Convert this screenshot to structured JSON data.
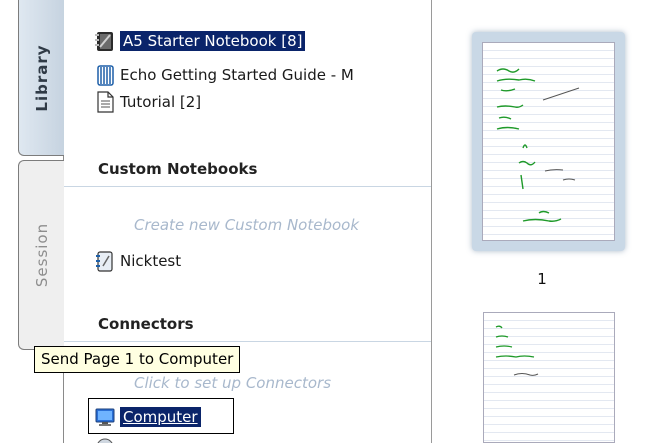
{
  "tabs": {
    "library": "Library",
    "session": "Session"
  },
  "library": {
    "notebooks": [
      {
        "label": "A5 Starter Notebook [8]",
        "icon": "notebook-icon",
        "selected": true
      },
      {
        "label": "Echo Getting Started Guide - M",
        "icon": "spiral-guide-icon",
        "selected": false
      },
      {
        "label": "Tutorial [2]",
        "icon": "document-icon",
        "selected": false
      }
    ],
    "custom_notebooks": {
      "header": "Custom Notebooks",
      "create_link": "Create new Custom Notebook",
      "items": [
        {
          "label": "Nicktest",
          "icon": "custom-notebook-icon"
        }
      ]
    },
    "connectors": {
      "header": "Connectors",
      "setup_link": "Click to set up Connectors",
      "items": [
        {
          "label": "Computer",
          "icon": "computer-icon"
        }
      ]
    }
  },
  "tooltip": {
    "text": "Send Page 1 to Computer"
  },
  "thumbnails": {
    "page_numbers": [
      "1"
    ]
  },
  "colors": {
    "selection": "#0a246a",
    "link": "#a8b8cc",
    "tooltip_bg": "#ffffe1",
    "ink": "#1f9a2a",
    "tab_active": "#c6d3e0"
  }
}
